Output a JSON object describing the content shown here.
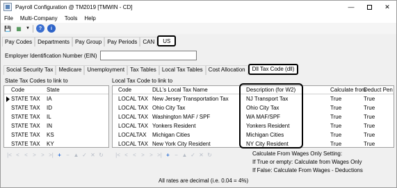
{
  "window": {
    "title": "Payroll Configuration @ TM2019 [TMWIN - CD]",
    "minimize_glyph": "—",
    "close_glyph": "✕"
  },
  "menu": {
    "items": [
      "File",
      "Multi-Company",
      "Tools",
      "Help"
    ]
  },
  "toolbar": {
    "icons": [
      "save-icon",
      "grid-icon",
      "dropdown-icon",
      "help-icon",
      "info-icon"
    ],
    "glyphs": {
      "save": "💾",
      "grid": "▦",
      "dropdown": "▼",
      "help": "?",
      "info": "i"
    }
  },
  "tabs": {
    "items": [
      "Pay Codes",
      "Departments",
      "Pay Group",
      "Pay Periods",
      "CAN",
      "US"
    ],
    "active": "US"
  },
  "ein": {
    "label": "Employer Identification Number (EIN)",
    "value": ""
  },
  "subtabs": {
    "items": [
      "Social Security Tax",
      "Medicare",
      "Unemployment",
      "Tax Tables",
      "Local Tax Tables",
      "Cost Allocation",
      "Dll Tax Code (dll)"
    ],
    "active": "Dll Tax Code (dll)"
  },
  "state_panel": {
    "title": "State Tax Codes to link to",
    "columns": [
      "Code",
      "State"
    ],
    "rows": [
      [
        "STATE TAX",
        "IA"
      ],
      [
        "STATE TAX",
        "ID"
      ],
      [
        "STATE TAX",
        "IL"
      ],
      [
        "STATE TAX",
        "IN"
      ],
      [
        "STATE TAX",
        "KS"
      ],
      [
        "STATE TAX",
        "KY"
      ]
    ]
  },
  "local_panel": {
    "title": "Local Tax Code to link to",
    "columns": [
      "Code",
      "DLL's Local Tax Name",
      "Description (for W2)",
      "Calculate from",
      "Deduct Pen"
    ],
    "rows": [
      [
        "LOCAL TAX",
        "New Jersey Transportation Tax",
        "NJ Transport Tax",
        "True",
        "True"
      ],
      [
        "LOCAL TAX",
        "Ohio City Tax",
        "Ohio City Tax",
        "True",
        "True"
      ],
      [
        "LOCAL TAX",
        "Washington MAF / SPF",
        "WA MAF/SPF",
        "True",
        "True"
      ],
      [
        "LOCAL TAX",
        "Yonkers Resident",
        "Yonkers Resident",
        "True",
        "True"
      ],
      [
        "LOCALTAX",
        "Michigan Cities",
        "Michigan Cities",
        "True",
        "True"
      ],
      [
        "LOCAL TAX",
        "New York City Resident",
        "NY City Resident",
        "True",
        "True"
      ]
    ]
  },
  "navigator": {
    "buttons": [
      "|<",
      "<",
      "<",
      ">",
      ">",
      ">|",
      "+",
      "−",
      "▲",
      "✓",
      "✕",
      "↻"
    ]
  },
  "calc_notes": [
    "Calculate From Wages Only Setting:",
    "If True or empty: Calculate from Wages Only",
    "If False: Calculate From Wages - Deductions"
  ],
  "footer_note": "All rates are decimal (i.e. 0.04 = 4%)",
  "colors": {
    "active_highlight": "#000000",
    "nav_plus": "#2a6fd6",
    "nav_disabled": "#b6bcc6"
  }
}
